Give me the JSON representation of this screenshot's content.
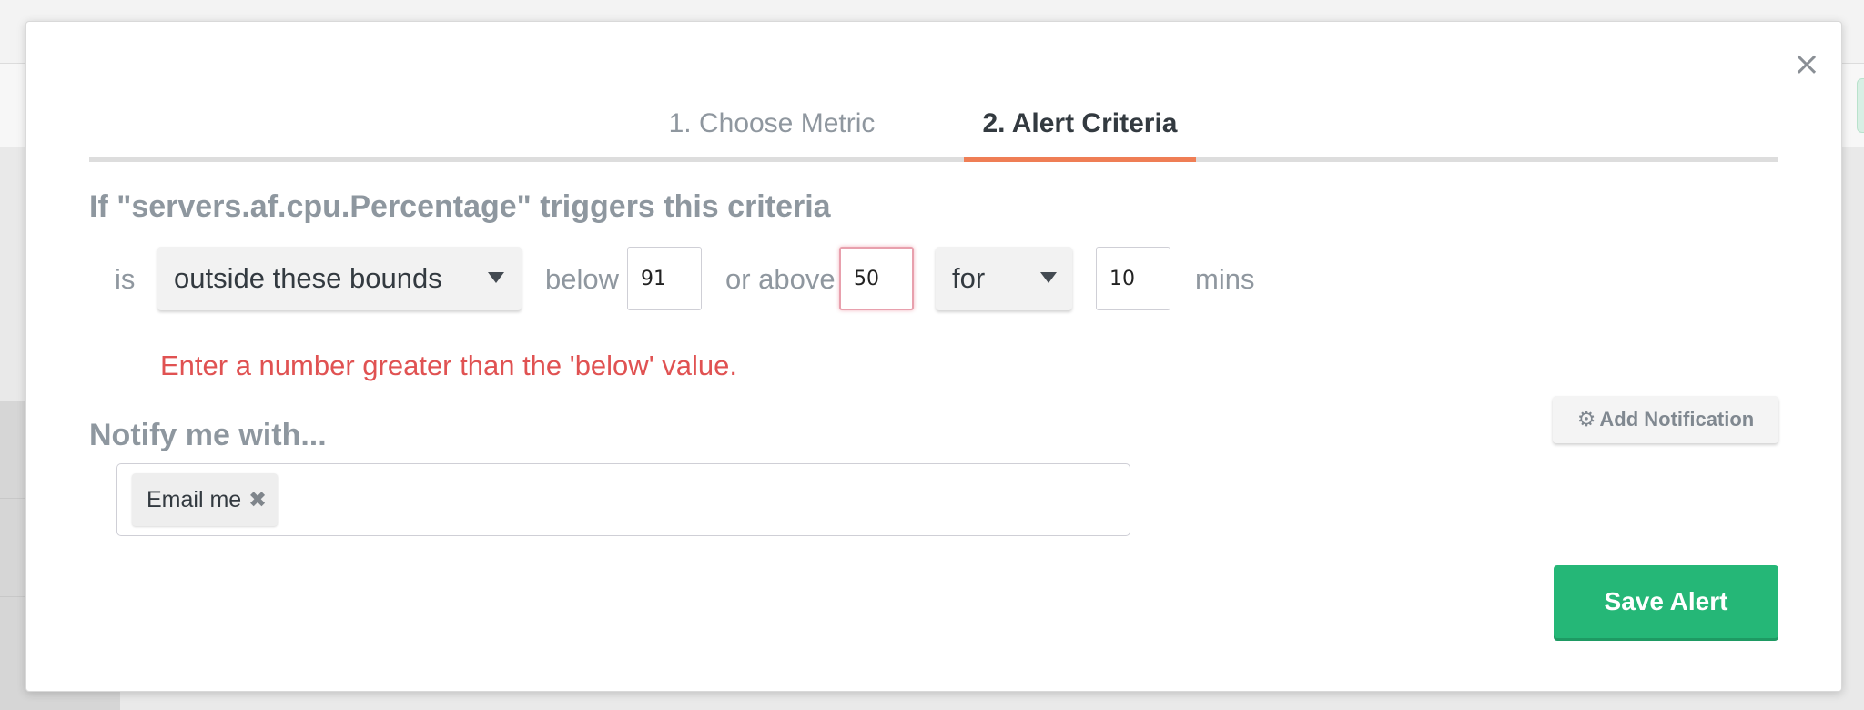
{
  "modal": {
    "close_glyph": "×",
    "tabs": [
      {
        "label": "1. Choose Metric",
        "active": false
      },
      {
        "label": "2. Alert Criteria",
        "active": true
      }
    ],
    "heading": "If \"servers.af.cpu.Percentage\" triggers this criteria",
    "criteria": {
      "is_label": "is",
      "condition_value": "outside these bounds",
      "below_label": "below",
      "below_value": "91",
      "or_above_label": "or above",
      "above_value": "50",
      "duration_mode": "for",
      "duration_value": "10",
      "duration_unit": "mins"
    },
    "error_message": "Enter a number greater than the 'below' value.",
    "notify": {
      "heading": "Notify me with...",
      "add_button_label": "Add Notification",
      "add_button_icon": "gear-icon",
      "tags": [
        {
          "label": "Email me"
        }
      ]
    },
    "save_label": "Save Alert"
  },
  "colors": {
    "accent_tab": "#ef7e55",
    "error": "#e05252",
    "save_button": "#25b777"
  }
}
